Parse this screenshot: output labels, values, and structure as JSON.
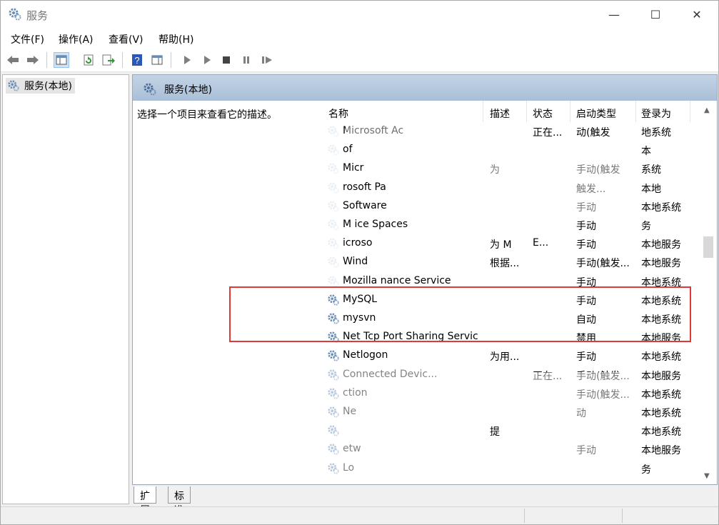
{
  "window": {
    "title": "服务",
    "controls": {
      "minimize": "—",
      "maximize": "☐",
      "close": "✕"
    }
  },
  "menu": {
    "items": [
      "文件(F)",
      "操作(A)",
      "查看(V)",
      "帮助(H)"
    ]
  },
  "tree": {
    "root_label": "服务(本地)"
  },
  "detail": {
    "header_title": "服务(本地)",
    "description": "选择一个项目来查看它的描述。"
  },
  "columns": {
    "name": "名称",
    "description": "描述",
    "status": "状态",
    "startup": "启动类型",
    "logon": "登录为"
  },
  "rows": [
    {
      "name": "Microsoft Ac",
      "desc": "",
      "status": "正在...",
      "startup": "动(触发",
      "logon": "地系统"
    },
    {
      "name": "of",
      "desc": "",
      "status": "",
      "startup": "",
      "logon": "本"
    },
    {
      "name": "Micr",
      "desc": "为",
      "status": "",
      "startup": "手动(触发",
      "logon": "系统"
    },
    {
      "name": "rosoft Pa",
      "desc": "",
      "status": "",
      "startup": "触发...",
      "logon": "本地"
    },
    {
      "name": "Software",
      "desc": "",
      "status": "",
      "startup": "手动",
      "logon": "本地系统"
    },
    {
      "name": "M          ice Spaces",
      "desc": "",
      "status": "",
      "startup": "手动",
      "logon": "务"
    },
    {
      "name": "icroso",
      "desc": "为 M",
      "status": "E...",
      "startup": "手动",
      "logon": "本地服务"
    },
    {
      "name": "Wind",
      "desc": "根据...",
      "status": "",
      "startup": "手动(触发...",
      "logon": "本地服务"
    },
    {
      "name": "Mozilla        nance Service",
      "desc": "",
      "status": "",
      "startup": "手动",
      "logon": "本地系统"
    },
    {
      "name": "MySQL",
      "desc": "",
      "status": "",
      "startup": "手动",
      "logon": "本地系统"
    },
    {
      "name": "mysvn",
      "desc": "",
      "status": "",
      "startup": "自动",
      "logon": "本地系统"
    },
    {
      "name": "Net Tcp Port Sharing Service",
      "desc": "",
      "status": "",
      "startup": "禁用",
      "logon": "本地服务"
    },
    {
      "name": "Netlogon",
      "desc": "为用...",
      "status": "",
      "startup": "手动",
      "logon": "本地系统"
    },
    {
      "name": "Connected Devic...",
      "desc": "",
      "status": "正在...",
      "startup": "手动(触发...",
      "logon": "本地服务"
    },
    {
      "name": "ction",
      "desc": "",
      "status": "",
      "startup": "手动(触发...",
      "logon": "本地系统"
    },
    {
      "name": "Ne",
      "desc": "",
      "status": "",
      "startup": "动",
      "logon": "本地系统"
    },
    {
      "name": "",
      "desc": "提",
      "status": "",
      "startup": "",
      "logon": "本地系统"
    },
    {
      "name": "etw",
      "desc": "",
      "status": "",
      "startup": "手动",
      "logon": "本地服务"
    },
    {
      "name": "Lo",
      "desc": "",
      "status": "",
      "startup": "",
      "logon": "务"
    }
  ],
  "tabs": {
    "extended": "扩展",
    "standard": "标准"
  },
  "colors": {
    "highlight": "#e0393a",
    "header_bg": "#b4c6dc"
  }
}
